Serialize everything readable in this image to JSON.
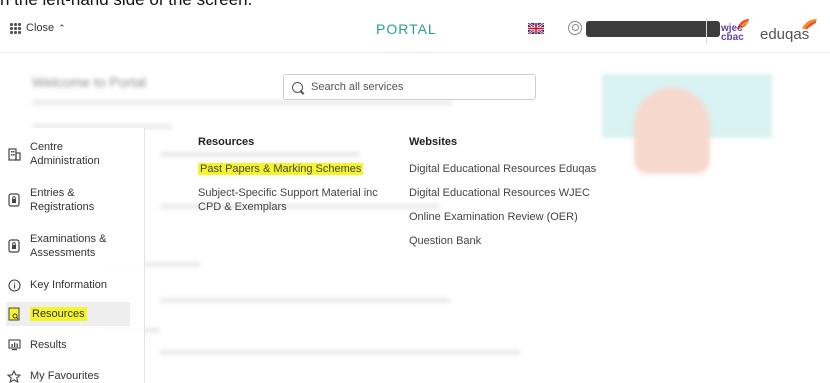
{
  "caption": "n the left-hand side of the screen.",
  "header": {
    "close_label": "Close",
    "portal_title": "PORTAL",
    "wjec_line1": "wjec",
    "wjec_line2": "cbac",
    "eduqas_label": "eduqas"
  },
  "background": {
    "welcome_title": "Welcome to Portal"
  },
  "search": {
    "placeholder": "Search all services"
  },
  "sidebar": {
    "items": [
      {
        "label": "Centre Administration",
        "icon": "building-icon"
      },
      {
        "label": "Entries & Registrations",
        "icon": "document-lock-icon"
      },
      {
        "label": "Examinations & Assessments",
        "icon": "document-lock-icon"
      },
      {
        "label": "Key Information",
        "icon": "info-icon"
      },
      {
        "label": "Resources",
        "icon": "folder-search-icon"
      },
      {
        "label": "Results",
        "icon": "chart-icon"
      },
      {
        "label": "My Favourites",
        "icon": "star-icon"
      }
    ]
  },
  "resources": {
    "heading": "Resources",
    "links": [
      "Past Papers & Marking Schemes",
      "Subject-Specific Support Material inc CPD & Exemplars"
    ]
  },
  "websites": {
    "heading": "Websites",
    "links": [
      "Digital Educational Resources Eduqas",
      "Digital Educational Resources WJEC",
      "Online Examination Review (OER)",
      "Question Bank"
    ]
  },
  "colors": {
    "accent": "#2a9d9a",
    "highlight": "#f5f52a",
    "brand_purple": "#6a3fa0"
  }
}
